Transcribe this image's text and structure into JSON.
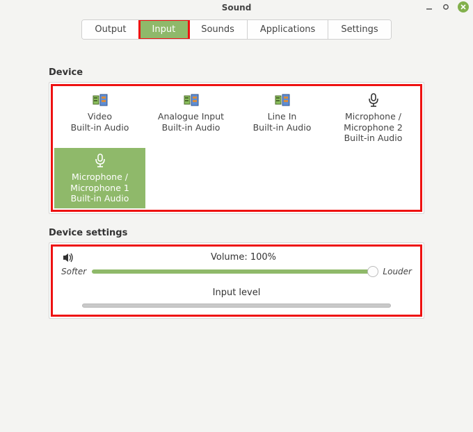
{
  "window": {
    "title": "Sound",
    "min": "—",
    "max": "❐",
    "close": "✕"
  },
  "tabs": {
    "output": "Output",
    "input": "Input",
    "sounds": "Sounds",
    "applications": "Applications",
    "settings": "Settings"
  },
  "section": {
    "device": "Device",
    "device_settings": "Device settings"
  },
  "devices": [
    {
      "line1": "Video",
      "line2": "Built-in Audio",
      "icon": "card",
      "selected": false
    },
    {
      "line1": "Analogue Input",
      "line2": "Built-in Audio",
      "icon": "card",
      "selected": false
    },
    {
      "line1": "Line In",
      "line2": "Built-in Audio",
      "icon": "card",
      "selected": false
    },
    {
      "line1": "Microphone / Microphone 2",
      "line2": "Built-in Audio",
      "icon": "mic",
      "selected": false
    },
    {
      "line1": "Microphone / Microphone 1",
      "line2": "Built-in Audio",
      "icon": "mic",
      "selected": true
    }
  ],
  "volume": {
    "label": "Volume: 100%",
    "softer": "Softer",
    "louder": "Louder",
    "percent": 100
  },
  "input_level": {
    "label": "Input level"
  }
}
